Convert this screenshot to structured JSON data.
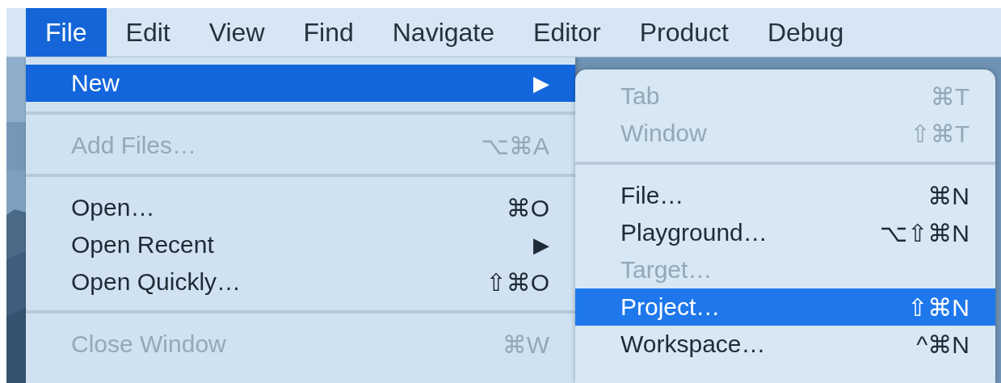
{
  "menubar": [
    {
      "label": "File",
      "selected": true
    },
    {
      "label": "Edit",
      "selected": false
    },
    {
      "label": "View",
      "selected": false
    },
    {
      "label": "Find",
      "selected": false
    },
    {
      "label": "Navigate",
      "selected": false
    },
    {
      "label": "Editor",
      "selected": false
    },
    {
      "label": "Product",
      "selected": false
    },
    {
      "label": "Debug",
      "selected": false
    }
  ],
  "menu": {
    "items": [
      {
        "kind": "item",
        "label": "New",
        "arrow": "▶",
        "disabled": false,
        "selected": true
      },
      {
        "kind": "separator"
      },
      {
        "kind": "item",
        "label": "Add Files…",
        "shortcut": "⌥⌘A",
        "disabled": true,
        "selected": false
      },
      {
        "kind": "separator"
      },
      {
        "kind": "item",
        "label": "Open…",
        "shortcut": "⌘O",
        "disabled": false,
        "selected": false
      },
      {
        "kind": "item",
        "label": "Open Recent",
        "arrow": "▶",
        "disabled": false,
        "selected": false
      },
      {
        "kind": "item",
        "label": "Open Quickly…",
        "shortcut": "⇧⌘O",
        "disabled": false,
        "selected": false
      },
      {
        "kind": "separator"
      },
      {
        "kind": "item",
        "label": "Close Window",
        "shortcut": "⌘W",
        "disabled": true,
        "selected": false
      }
    ]
  },
  "submenu": {
    "items": [
      {
        "kind": "item",
        "label": "Tab",
        "shortcut": "⌘T",
        "disabled": true,
        "selected": false
      },
      {
        "kind": "item",
        "label": "Window",
        "shortcut": "⇧⌘T",
        "disabled": true,
        "selected": false
      },
      {
        "kind": "separator"
      },
      {
        "kind": "item",
        "label": "File…",
        "shortcut": "⌘N",
        "disabled": false,
        "selected": false
      },
      {
        "kind": "item",
        "label": "Playground…",
        "shortcut": "⌥⇧⌘N",
        "disabled": false,
        "selected": false
      },
      {
        "kind": "item",
        "label": "Target…",
        "disabled": true,
        "selected": false
      },
      {
        "kind": "item",
        "label": "Project…",
        "shortcut": "⇧⌘N",
        "disabled": false,
        "selected": true
      },
      {
        "kind": "item",
        "label": "Workspace…",
        "shortcut": "^⌘N",
        "disabled": false,
        "selected": false
      }
    ]
  }
}
